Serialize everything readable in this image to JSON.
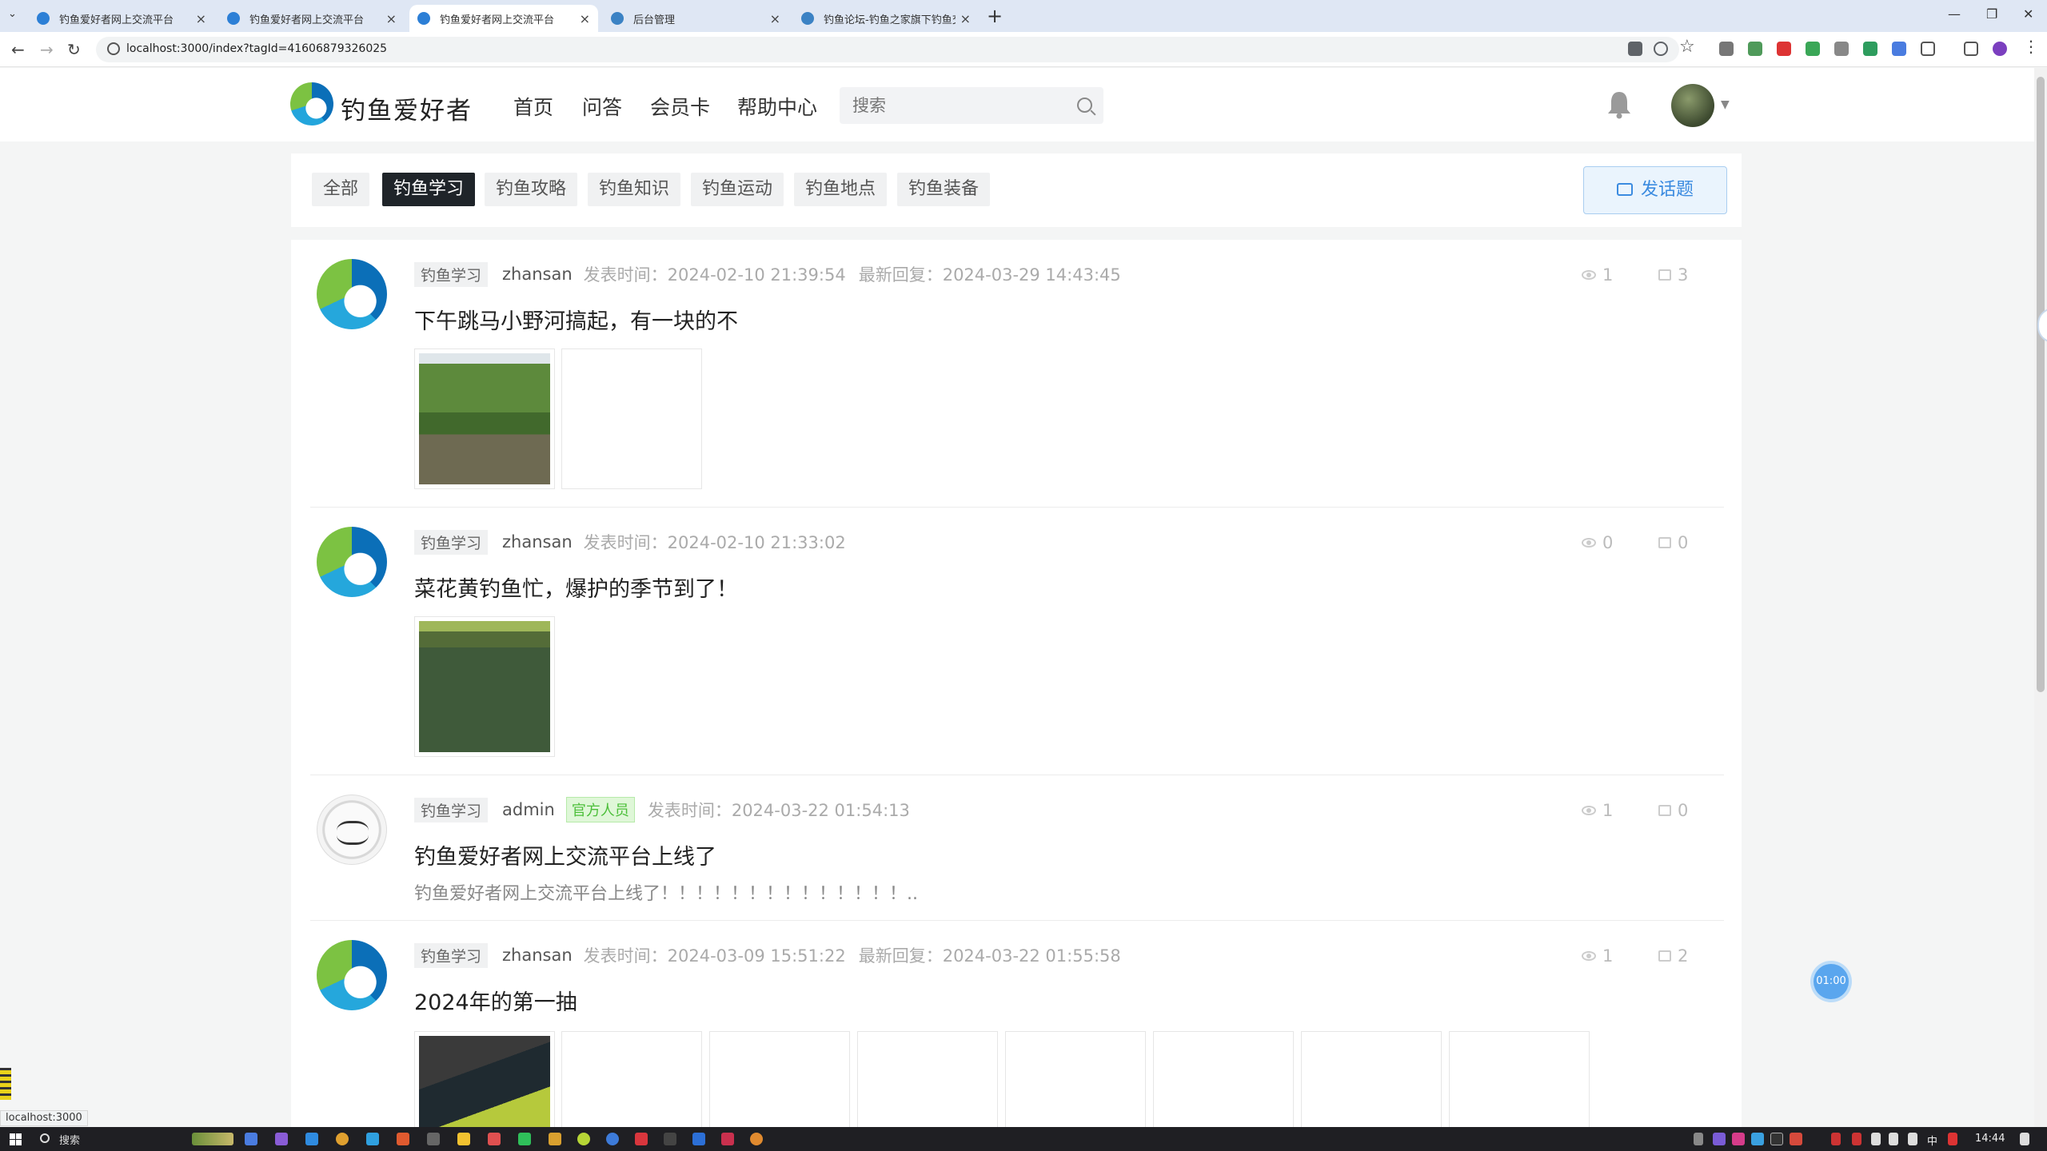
{
  "browser": {
    "tabs": [
      {
        "label": "钓鱼爱好者网上交流平台"
      },
      {
        "label": "钓鱼爱好者网上交流平台"
      },
      {
        "label": "钓鱼爱好者网上交流平台"
      },
      {
        "label": "后台管理"
      },
      {
        "label": "钓鱼论坛-钓鱼之家旗下钓鱼交"
      }
    ],
    "url": "localhost:3000/index?tagId=41606879326025",
    "status_link": "localhost:3000"
  },
  "header": {
    "logo_text": "钓鱼爱好者",
    "nav": [
      "首页",
      "问答",
      "会员卡",
      "帮助中心"
    ],
    "search_placeholder": "搜索"
  },
  "categories": {
    "items": [
      "全部",
      "钓鱼学习",
      "钓鱼攻略",
      "钓鱼知识",
      "钓鱼运动",
      "钓鱼地点",
      "钓鱼装备"
    ],
    "active": "钓鱼学习",
    "post_button": "发话题"
  },
  "posts": [
    {
      "tag": "钓鱼学习",
      "author": "zhansan",
      "time": "发表时间：2024-02-10 21:39:54",
      "reply": "最新回复：2024-03-29 14:43:45",
      "views": "1",
      "comments": "3",
      "title": "下午跳马小野河搞起，有一块的不"
    },
    {
      "tag": "钓鱼学习",
      "author": "zhansan",
      "time": "发表时间：2024-02-10 21:33:02",
      "views": "0",
      "comments": "0",
      "title": "菜花黄钓鱼忙，爆护的季节到了！"
    },
    {
      "tag": "钓鱼学习",
      "author": "admin",
      "badge": "官方人员",
      "time": "发表时间：2024-03-22 01:54:13",
      "views": "1",
      "comments": "0",
      "title": "钓鱼爱好者网上交流平台上线了",
      "excerpt": "钓鱼爱好者网上交流平台上线了！！！！！！！！！！！！！！.."
    },
    {
      "tag": "钓鱼学习",
      "author": "zhansan",
      "time": "发表时间：2024-03-09 15:51:22",
      "reply": "最新回复：2024-03-22 01:55:58",
      "views": "1",
      "comments": "2",
      "title": "2024年的第一抽"
    }
  ],
  "timer": "01:00",
  "taskbar": {
    "search": "搜索",
    "ime": "中",
    "clock": "14:44"
  },
  "colors": {
    "accent": "#3b8be0",
    "active_chip": "#1f2429",
    "official": "#4cbf3a"
  }
}
